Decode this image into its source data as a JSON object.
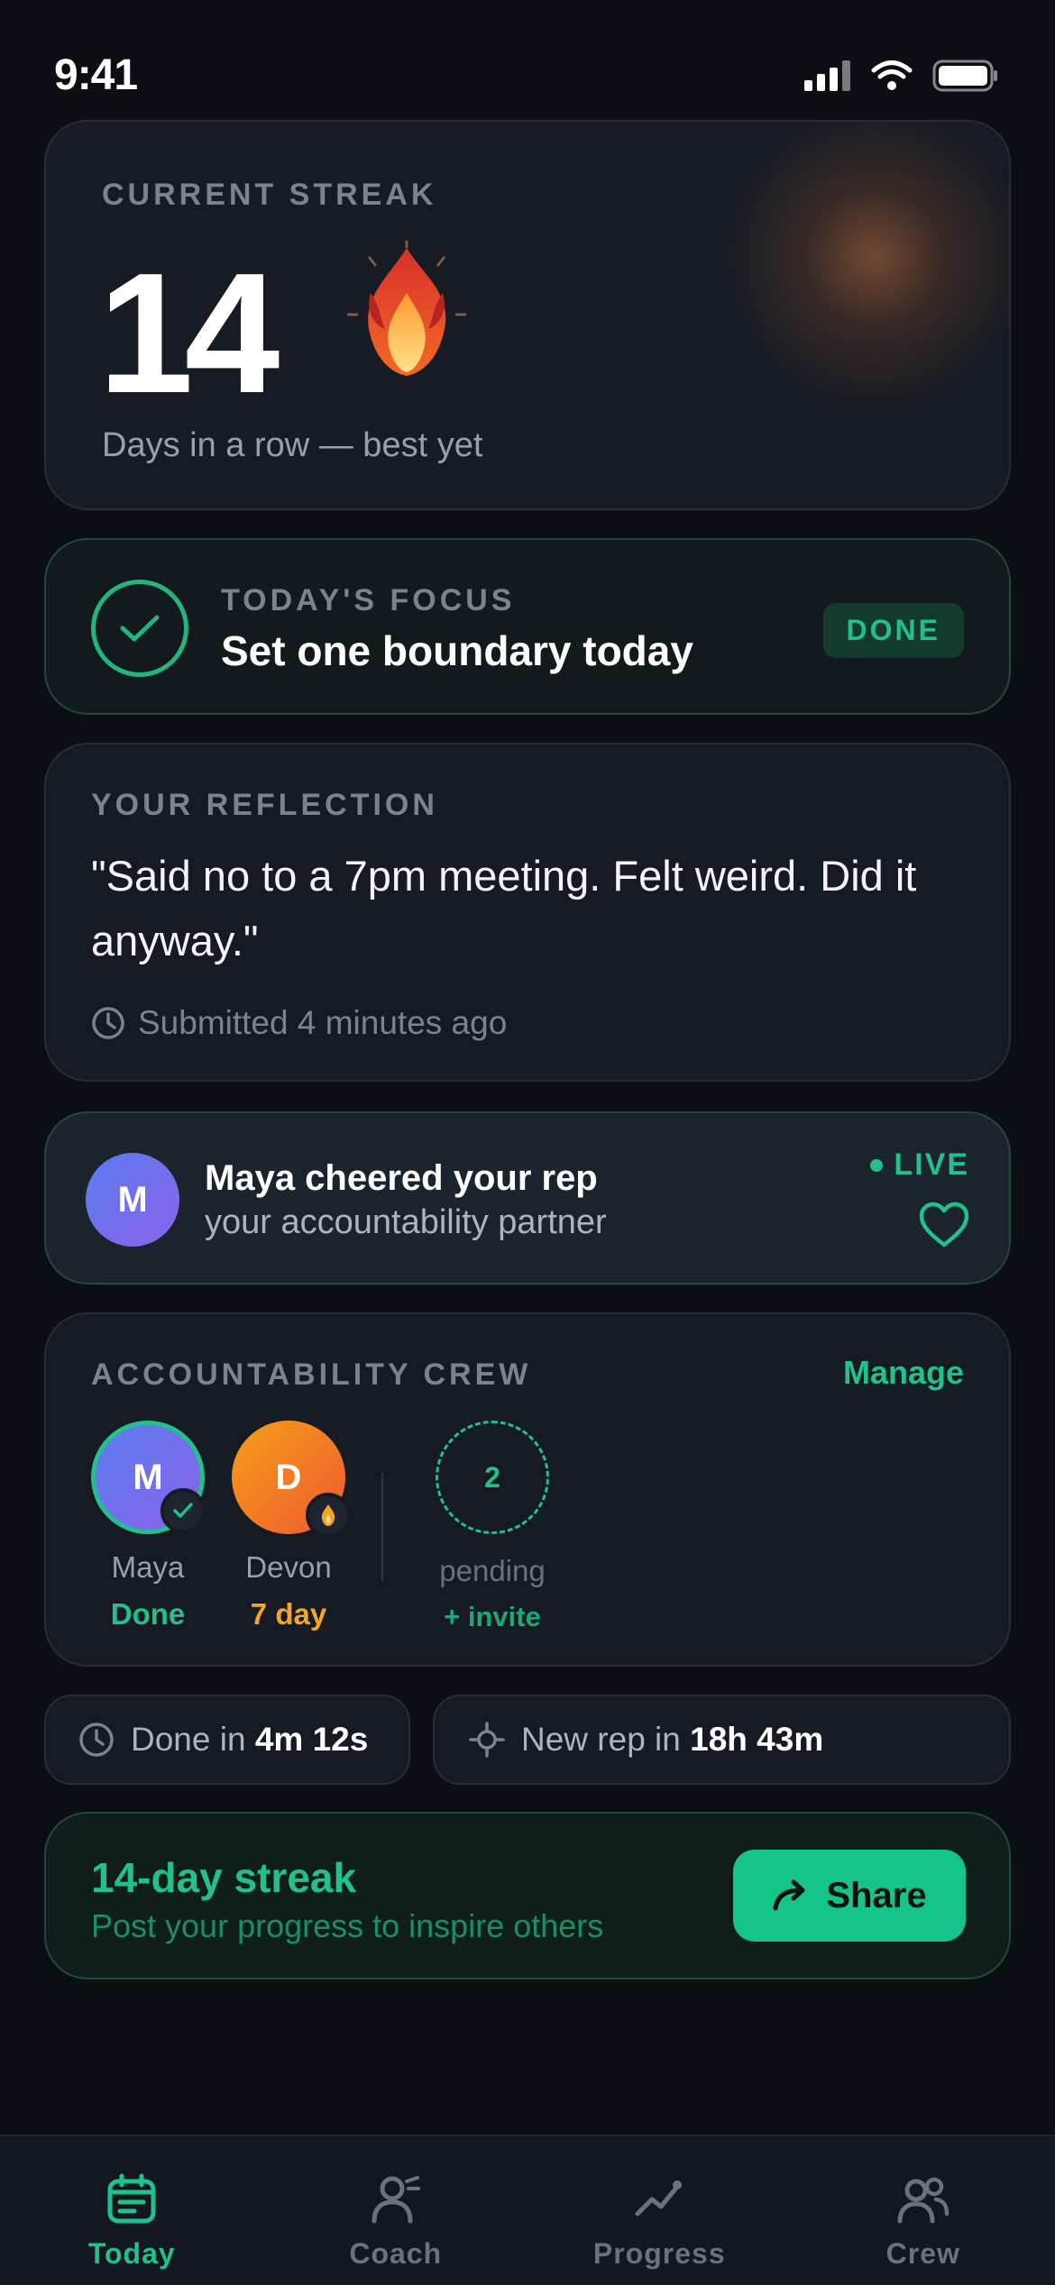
{
  "status_bar": {
    "time": "9:41"
  },
  "streak": {
    "label": "CURRENT STREAK",
    "count": "14",
    "subtitle": "Days in a row — best yet"
  },
  "focus": {
    "eyebrow": "TODAY'S FOCUS",
    "title": "Set one boundary today",
    "badge": "DONE"
  },
  "reflection": {
    "eyebrow": "YOUR REFLECTION",
    "text": "\"Said no to a 7pm meeting. Felt weird. Did it anyway.\"",
    "meta": "Submitted 4 minutes ago"
  },
  "cheer": {
    "avatar_initial": "M",
    "title": "Maya cheered your rep",
    "subtitle": "your accountability partner",
    "live_label": "LIVE"
  },
  "crew": {
    "eyebrow": "ACCOUNTABILITY CREW",
    "manage_label": "Manage",
    "members": [
      {
        "initial": "M",
        "name": "Maya",
        "state": "Done",
        "state_color": "#22c08a",
        "badge_icon": "check-icon"
      },
      {
        "initial": "D",
        "name": "Devon",
        "state": "7 day",
        "state_color": "#f5a524",
        "badge_icon": "flame-icon"
      }
    ],
    "pending": {
      "count": "2",
      "label": "pending",
      "invite_label": "+ invite"
    }
  },
  "timers": {
    "done_prefix": "Done in",
    "done_value": "4m 12s",
    "next_prefix": "New rep in",
    "next_value": "18h 43m"
  },
  "share": {
    "title": "14-day streak",
    "subtitle": "Post your progress to inspire others",
    "button_label": "Share"
  },
  "tabs": [
    {
      "label": "Today",
      "icon": "calendar-icon",
      "active": true
    },
    {
      "label": "Coach",
      "icon": "coach-icon",
      "active": false
    },
    {
      "label": "Progress",
      "icon": "chart-line-icon",
      "active": false
    },
    {
      "label": "Crew",
      "icon": "people-icon",
      "active": false
    }
  ],
  "colors": {
    "accent": "#22c08a",
    "background": "#0b0f14",
    "card": "#161b23",
    "warning": "#f5a524"
  }
}
